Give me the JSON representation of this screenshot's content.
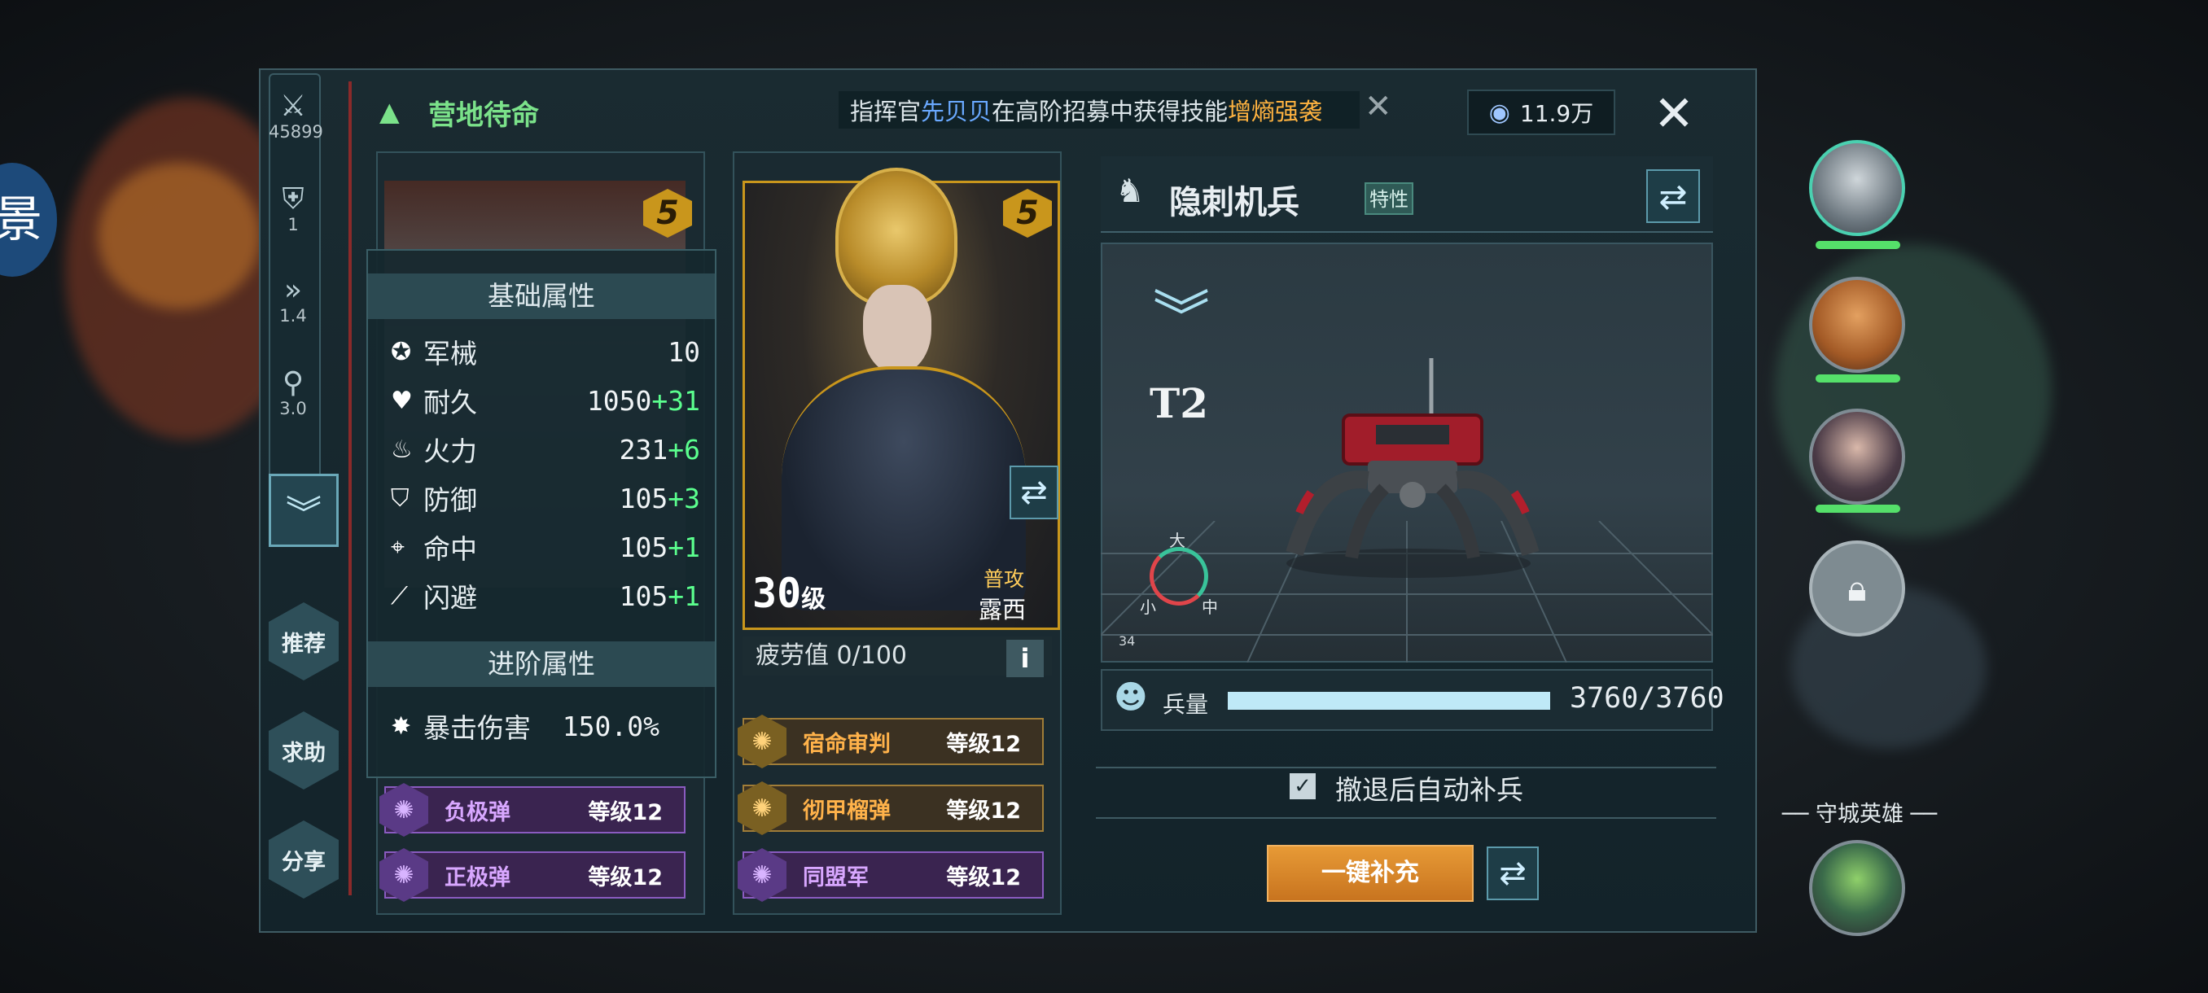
{
  "header": {
    "title": "营地待命",
    "notice": {
      "prefix": "指挥官",
      "name": "先贝贝",
      "middle": "在高阶招募中获得技能",
      "skill": "增熵强袭"
    },
    "currency": "11.9万"
  },
  "rail": {
    "power": "45899",
    "troops": "1",
    "speed": "1.4",
    "range": "3.0"
  },
  "side_buttons": [
    "推荐",
    "求助",
    "分享"
  ],
  "left_hero": {
    "star": "5",
    "base_attr_title": "基础属性",
    "attrs": [
      {
        "label": "军械",
        "value": "10",
        "plus": ""
      },
      {
        "label": "耐久",
        "value": "1050",
        "plus": "+31"
      },
      {
        "label": "火力",
        "value": "231",
        "plus": "+6"
      },
      {
        "label": "防御",
        "value": "105",
        "plus": "+3"
      },
      {
        "label": "命中",
        "value": "105",
        "plus": "+1"
      },
      {
        "label": "闪避",
        "value": "105",
        "plus": "+1"
      }
    ],
    "adv_attr_title": "进阶属性",
    "adv_attrs": [
      {
        "label": "暴击伤害",
        "value": "150.0%"
      }
    ],
    "skills": [
      {
        "name": "负极弹",
        "level": "等级12"
      },
      {
        "name": "正极弹",
        "level": "等级12"
      }
    ]
  },
  "main_hero": {
    "star": "5",
    "level": "30",
    "level_unit": "级",
    "attack_type": "普攻",
    "name": "露西",
    "fatigue": "疲劳值 0/100",
    "info": "i",
    "skills": [
      {
        "name": "宿命审判",
        "level": "等级12",
        "tier": "gold"
      },
      {
        "name": "彻甲榴弹",
        "level": "等级12",
        "tier": "gold"
      },
      {
        "name": "同盟军",
        "level": "等级12",
        "tier": "purple"
      }
    ]
  },
  "unit": {
    "name": "隐刺机兵",
    "trait": "特性",
    "tier": "T2",
    "size_big": "大",
    "size_small": "小",
    "size_mid": "中",
    "marker": "34",
    "troop_label": "兵量",
    "troop_value": "3760/3760",
    "troop_fraction": 1.0,
    "auto_refill_label": "撤退后自动补兵",
    "auto_refill_checked": true,
    "refill_button": "一键补充"
  },
  "right_bar": {
    "defender_label": "守城英雄"
  },
  "colors": {
    "accent_green": "#7be28a",
    "gold": "#ffb24a",
    "purple": "#d8a7ff",
    "troop_bar": "#bfe9f7",
    "refill_btn": "#d7892a"
  },
  "icons": [
    "close-icon",
    "swap-icon",
    "chevron-down-icon",
    "lock-icon",
    "crystal-icon",
    "swords-icon",
    "shield-icon",
    "target-icon",
    "fire-icon",
    "heart-icon",
    "gear-icon",
    "wing-icon",
    "troop-icon",
    "check-icon",
    "info-icon"
  ]
}
